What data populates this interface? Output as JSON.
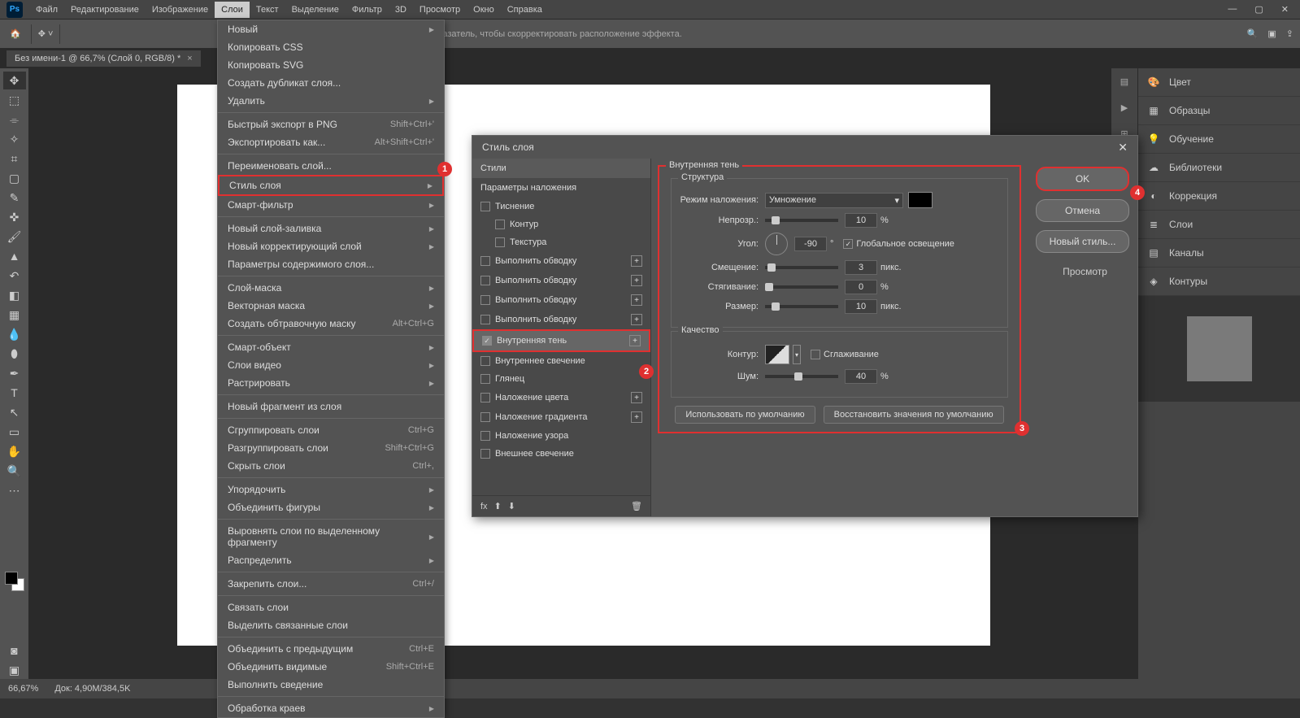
{
  "menubar": [
    "Файл",
    "Редактирование",
    "Изображение",
    "Слои",
    "Текст",
    "Выделение",
    "Фильтр",
    "3D",
    "Просмотр",
    "Окно",
    "Справка"
  ],
  "menubar_active": 3,
  "toolbar_hint": "и перетаскивайте ее указатель, чтобы скорректировать расположение эффекта.",
  "tab": {
    "title": "Без имени-1 @ 66,7% (Слой 0, RGB/8) *"
  },
  "status": {
    "zoom": "66,67%",
    "doc": "Док: 4,90M/384,5K"
  },
  "dropdown": [
    {
      "t": "Новый",
      "sub": true
    },
    {
      "t": "Копировать CSS"
    },
    {
      "t": "Копировать SVG"
    },
    {
      "t": "Создать дубликат слоя..."
    },
    {
      "t": "Удалить",
      "sub": true
    },
    {
      "sep": true
    },
    {
      "t": "Быстрый экспорт в PNG",
      "sc": "Shift+Ctrl+'"
    },
    {
      "t": "Экспортировать как...",
      "sc": "Alt+Shift+Ctrl+'"
    },
    {
      "sep": true
    },
    {
      "t": "Переименовать слой..."
    },
    {
      "t": "Стиль слоя",
      "sub": true,
      "hl": true
    },
    {
      "t": "Смарт-фильтр",
      "sub": true
    },
    {
      "sep": true
    },
    {
      "t": "Новый слой-заливка",
      "sub": true
    },
    {
      "t": "Новый корректирующий слой",
      "sub": true
    },
    {
      "t": "Параметры содержимого слоя..."
    },
    {
      "sep": true
    },
    {
      "t": "Слой-маска",
      "sub": true
    },
    {
      "t": "Векторная маска",
      "sub": true
    },
    {
      "t": "Создать обтравочную маску",
      "sc": "Alt+Ctrl+G"
    },
    {
      "sep": true
    },
    {
      "t": "Смарт-объект",
      "sub": true
    },
    {
      "t": "Слои видео",
      "sub": true
    },
    {
      "t": "Растрировать",
      "sub": true
    },
    {
      "sep": true
    },
    {
      "t": "Новый фрагмент из слоя"
    },
    {
      "sep": true
    },
    {
      "t": "Сгруппировать слои",
      "sc": "Ctrl+G"
    },
    {
      "t": "Разгруппировать слои",
      "sc": "Shift+Ctrl+G"
    },
    {
      "t": "Скрыть слои",
      "sc": "Ctrl+,"
    },
    {
      "sep": true
    },
    {
      "t": "Упорядочить",
      "sub": true
    },
    {
      "t": "Объединить фигуры",
      "sub": true
    },
    {
      "sep": true
    },
    {
      "t": "Выровнять слои по выделенному фрагменту",
      "sub": true
    },
    {
      "t": "Распределить",
      "sub": true
    },
    {
      "sep": true
    },
    {
      "t": "Закрепить слои...",
      "sc": "Ctrl+/"
    },
    {
      "sep": true
    },
    {
      "t": "Связать слои"
    },
    {
      "t": "Выделить связанные слои"
    },
    {
      "sep": true
    },
    {
      "t": "Объединить с предыдущим",
      "sc": "Ctrl+E"
    },
    {
      "t": "Объединить видимые",
      "sc": "Shift+Ctrl+E"
    },
    {
      "t": "Выполнить сведение"
    },
    {
      "sep": true
    },
    {
      "t": "Обработка краев",
      "sub": true
    }
  ],
  "dialog": {
    "title": "Стиль слоя",
    "styles_hdr": "Стили",
    "blend_opts": "Параметры наложения",
    "style_items": [
      {
        "t": "Тиснение"
      },
      {
        "t": "Контур",
        "indent": true
      },
      {
        "t": "Текстура",
        "indent": true
      },
      {
        "t": "Выполнить обводку",
        "plus": true
      },
      {
        "t": "Выполнить обводку",
        "plus": true
      },
      {
        "t": "Выполнить обводку",
        "plus": true
      },
      {
        "t": "Выполнить обводку",
        "plus": true
      },
      {
        "t": "Внутренняя тень",
        "plus": true,
        "on": true,
        "active": true,
        "hl": true
      },
      {
        "t": "Внутреннее свечение"
      },
      {
        "t": "Глянец"
      },
      {
        "t": "Наложение цвета",
        "plus": true
      },
      {
        "t": "Наложение градиента",
        "plus": true
      },
      {
        "t": "Наложение узора"
      },
      {
        "t": "Внешнее свечение"
      }
    ],
    "section_title": "Внутренняя тень",
    "structure": "Структура",
    "quality": "Качество",
    "blend_mode_lbl": "Режим наложения:",
    "blend_mode": "Умножение",
    "opacity_lbl": "Непрозр.:",
    "opacity": "10",
    "angle_lbl": "Угол:",
    "angle": "-90",
    "global": "Глобальное освещение",
    "distance_lbl": "Смещение:",
    "distance": "3",
    "spread_lbl": "Стягивание:",
    "spread": "0",
    "size_lbl": "Размер:",
    "size": "10",
    "px": "пикс.",
    "contour_lbl": "Контур:",
    "anti": "Сглаживание",
    "noise_lbl": "Шум:",
    "noise": "40",
    "default": "Использовать по умолчанию",
    "reset": "Восстановить значения по умолчанию",
    "ok": "OK",
    "cancel": "Отмена",
    "newstyle": "Новый стиль...",
    "preview": "Просмотр"
  },
  "right_panel": [
    "Цвет",
    "Образцы",
    "Обучение",
    "Библиотеки",
    "Коррекция",
    "Слои",
    "Каналы",
    "Контуры"
  ],
  "markers": [
    "1",
    "2",
    "3",
    "4"
  ]
}
